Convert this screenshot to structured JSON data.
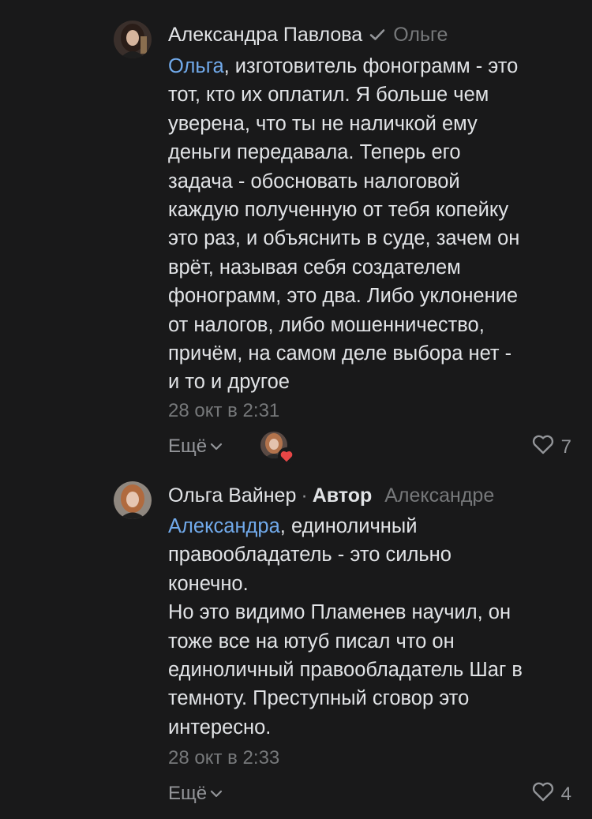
{
  "comments": [
    {
      "author": "Александра Павлова",
      "verified": true,
      "reply_to": "Ольге",
      "mention": "Ольга",
      "text": ", изготовитель фонограмм - это\nтот, кто их оплатил. Я больше чем\nуверена, что ты не наличкой ему\nденьги передавала. Теперь его\nзадача - обосновать налоговой\nкаждую полученную от тебя копейку\nэто раз, и объяснить в суде, зачем он\nврёт, называя себя создателем\nфонограмм, это два. Либо уклонение\nот налогов, либо мошенничество,\nпричём, на самом деле выбора нет -\nи то и другое",
      "time": "28 окт в 2:31",
      "more_label": "Ещё",
      "likes": "7",
      "liked_by_author": true
    },
    {
      "author": "Ольга Вайнер",
      "separator": "·",
      "role": "Автор",
      "reply_to": "Александре",
      "mention": "Александра",
      "text": ", единоличный\nправообладатель - это сильно\nконечно.\nНо это видимо Пламенев научил, он\nтоже все на ютуб писал что он\nединоличный правообладатель Шаг в\nтемноту. Преступный сговор это\nинтересно.",
      "time": "28 окт в 2:33",
      "more_label": "Ещё",
      "likes": "4"
    }
  ],
  "icons": {
    "verified": "check-icon",
    "more": "chevron-down-icon",
    "like": "heart-outline-icon",
    "liked_badge": "heart-filled-icon"
  },
  "colors": {
    "background": "#19191a",
    "text": "#e1e3e6",
    "secondary": "#76787a",
    "link": "#71aaeb",
    "like_red": "#e64646"
  }
}
